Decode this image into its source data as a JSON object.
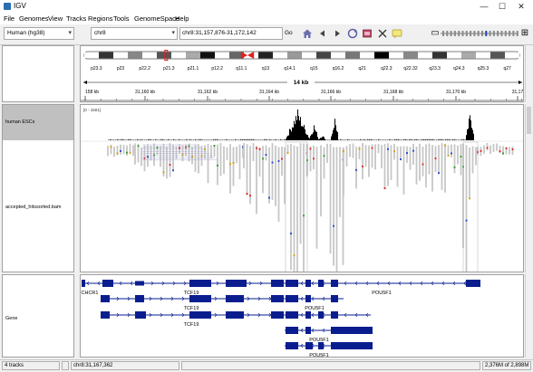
{
  "window": {
    "title": "IGV",
    "app_icon": "igv-app-icon",
    "controls": [
      "—",
      "☐",
      "✕"
    ]
  },
  "menu": [
    "File",
    "Genomes",
    "View",
    "Tracks",
    "Regions",
    "Tools",
    "GenomeSpace",
    "Help"
  ],
  "toolbar": {
    "genome": "Human (hg38)",
    "chromosome": "chr8",
    "locus": "chr8:31,157,876-31,172,142",
    "go_label": "Go",
    "icons": [
      "home-icon",
      "back-icon",
      "forward-icon",
      "refresh-icon",
      "region-of-interest-icon",
      "resize-icon",
      "close-icon",
      "popup-text-icon"
    ]
  },
  "ideogram": {
    "bands": [
      "p23.3",
      "p23",
      "p22.2",
      "p21.3",
      "p21.1",
      "p12.2",
      "q11.1",
      "q13",
      "q14.1",
      "q15",
      "q16.2",
      "q21",
      "q22.3",
      "q22.32",
      "q23.3",
      "q24.3",
      "q25.3",
      "q27"
    ],
    "span_label": "14 kb",
    "ruler_ticks": [
      "158 kb",
      "31,160 kb",
      "31,162 kb",
      "31,164 kb",
      "31,166 kb",
      "31,168 kb",
      "31,170 kb",
      "31,17"
    ]
  },
  "tracks": {
    "coverage_name": "human ESCs",
    "coverage_range": "[0 - 1501]",
    "alignment_name": "accepted_hitssorted.bam",
    "gene_track_name": "Gene",
    "gene_labels": [
      "CHCR1",
      "TCF19",
      "TCF19",
      "TCF19",
      "POU5F1",
      "POU5F1",
      "POU5F1",
      "POU5F1",
      "POU5F1"
    ]
  },
  "colors": {
    "gene": "#0a1d8f",
    "coverage": "#000000",
    "ideogram_centromere": "#e02020",
    "selected_track_label": "#c0c0c0"
  },
  "status": {
    "track_count": "4 tracks",
    "position": "chr8:31,167,362",
    "memory": "2,376M of 2,898M"
  }
}
